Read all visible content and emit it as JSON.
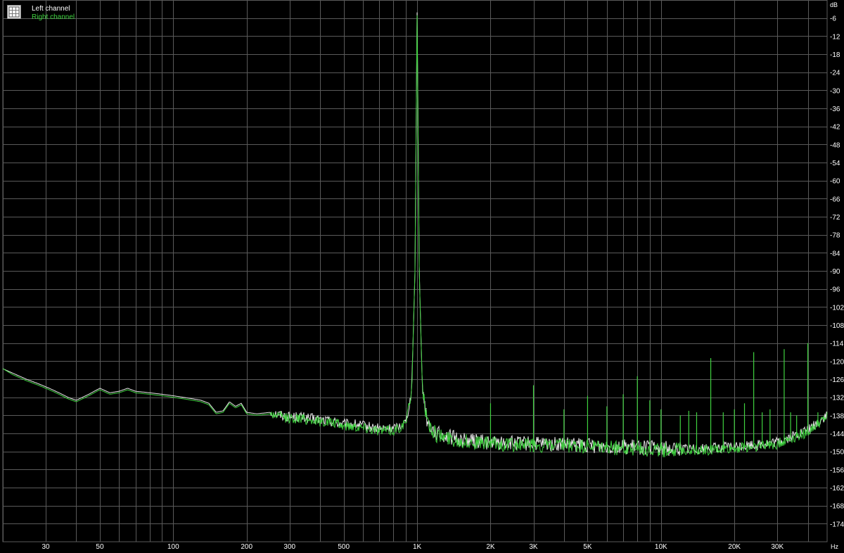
{
  "chart_data": {
    "type": "line",
    "title": "",
    "xlabel": "Hz",
    "ylabel": "dB",
    "x_scale": "log",
    "xlim": [
      20,
      48000
    ],
    "ylim": [
      -180,
      0
    ],
    "grid": true,
    "legend_position": "top-left",
    "background": "#000000",
    "grid_color": "#5a5a5a",
    "y_ticks": [
      -6,
      -12,
      -18,
      -24,
      -30,
      -36,
      -42,
      -48,
      -54,
      -60,
      -66,
      -72,
      -78,
      -84,
      -90,
      -96,
      -102,
      -108,
      -114,
      -120,
      -126,
      -132,
      -138,
      -144,
      -150,
      -156,
      -162,
      -168,
      -174
    ],
    "x_tick_labels": [
      {
        "x": 30,
        "label": "30"
      },
      {
        "x": 50,
        "label": "50"
      },
      {
        "x": 100,
        "label": "100"
      },
      {
        "x": 200,
        "label": "200"
      },
      {
        "x": 300,
        "label": "300"
      },
      {
        "x": 500,
        "label": "500"
      },
      {
        "x": 1000,
        "label": "1K"
      },
      {
        "x": 2000,
        "label": "2K"
      },
      {
        "x": 3000,
        "label": "3K"
      },
      {
        "x": 5000,
        "label": "5K"
      },
      {
        "x": 10000,
        "label": "10K"
      },
      {
        "x": 20000,
        "label": "20K"
      },
      {
        "x": 30000,
        "label": "30K"
      }
    ],
    "x_minor_gridlines": [
      20,
      30,
      40,
      50,
      60,
      70,
      80,
      90,
      100,
      200,
      300,
      400,
      500,
      600,
      700,
      800,
      900,
      1000,
      2000,
      3000,
      4000,
      5000,
      6000,
      7000,
      8000,
      9000,
      10000,
      20000,
      30000,
      40000
    ],
    "series": [
      {
        "name": "Left channel",
        "color": "#e8e8e8",
        "x": [
          20,
          22,
          25,
          28,
          31,
          34,
          37,
          40,
          45,
          50,
          55,
          60,
          65,
          70,
          80,
          90,
          100,
          110,
          120,
          130,
          140,
          150,
          160,
          170,
          180,
          190,
          200,
          220,
          250,
          280,
          300,
          330,
          360,
          400,
          450,
          500,
          550,
          600,
          650,
          700,
          750,
          800,
          850,
          900,
          950,
          980,
          1000,
          1020,
          1050,
          1100,
          1200,
          1500,
          2000,
          3000,
          5000,
          8000,
          10000,
          15000,
          20000,
          30000,
          40000,
          48000
        ],
        "y": [
          -122.5,
          -124,
          -126,
          -127.5,
          -129,
          -130.5,
          -132,
          -133,
          -131,
          -129,
          -130.5,
          -130,
          -129,
          -130,
          -130.5,
          -131,
          -131.5,
          -132,
          -132.5,
          -133,
          -134,
          -137,
          -136.5,
          -133.5,
          -135,
          -134,
          -137,
          -137.5,
          -137,
          -138,
          -138.5,
          -138.5,
          -139,
          -139.5,
          -140,
          -141,
          -141,
          -141.5,
          -142,
          -142.5,
          -142.5,
          -142.5,
          -141.5,
          -140,
          -130,
          -90,
          -2,
          -90,
          -128,
          -140,
          -144,
          -146,
          -147,
          -147.5,
          -148,
          -148.5,
          -149,
          -149,
          -148.5,
          -147,
          -143,
          -138
        ]
      },
      {
        "name": "Right channel",
        "color": "#3fd23f",
        "x": [
          20,
          22,
          25,
          28,
          31,
          34,
          37,
          40,
          45,
          50,
          55,
          60,
          65,
          70,
          80,
          90,
          100,
          110,
          120,
          130,
          140,
          150,
          160,
          170,
          180,
          190,
          200,
          220,
          250,
          280,
          300,
          330,
          360,
          400,
          450,
          500,
          550,
          600,
          650,
          700,
          750,
          800,
          850,
          900,
          950,
          980,
          1000,
          1020,
          1050,
          1100,
          1200,
          1500,
          2000,
          3000,
          5000,
          8000,
          10000,
          15000,
          20000,
          30000,
          40000,
          48000
        ],
        "y": [
          -122.5,
          -124.5,
          -126.5,
          -128,
          -129.5,
          -131,
          -132.5,
          -133.5,
          -131.5,
          -129.5,
          -131,
          -130.5,
          -129.5,
          -130.5,
          -131,
          -131.5,
          -132,
          -132.5,
          -133,
          -133.5,
          -134.5,
          -137.5,
          -137,
          -134,
          -135.5,
          -134.5,
          -137.5,
          -138,
          -137.5,
          -138.5,
          -139,
          -139,
          -139.5,
          -140,
          -140.5,
          -141.5,
          -141.5,
          -142,
          -142.5,
          -143,
          -143,
          -143,
          -142,
          -140.5,
          -130,
          -90,
          -3,
          -90,
          -128,
          -140.5,
          -144.5,
          -146.5,
          -147.5,
          -148,
          -148.5,
          -149,
          -149.5,
          -149.5,
          -149,
          -147.5,
          -143.5,
          -138.5
        ]
      }
    ],
    "harmonic_spikes": [
      {
        "x": 2000,
        "y": -134
      },
      {
        "x": 3000,
        "y": -128
      },
      {
        "x": 4000,
        "y": -136
      },
      {
        "x": 5000,
        "y": -131.5
      },
      {
        "x": 6000,
        "y": -135
      },
      {
        "x": 7000,
        "y": -131
      },
      {
        "x": 8000,
        "y": -125
      },
      {
        "x": 9000,
        "y": -133
      },
      {
        "x": 10000,
        "y": -136
      },
      {
        "x": 12000,
        "y": -138
      },
      {
        "x": 13000,
        "y": -136.5
      },
      {
        "x": 14000,
        "y": -137
      },
      {
        "x": 16000,
        "y": -119
      },
      {
        "x": 18000,
        "y": -137
      },
      {
        "x": 20000,
        "y": -136
      },
      {
        "x": 22000,
        "y": -134
      },
      {
        "x": 24000,
        "y": -117
      },
      {
        "x": 26000,
        "y": -137
      },
      {
        "x": 28000,
        "y": -136
      },
      {
        "x": 32000,
        "y": -116
      },
      {
        "x": 34000,
        "y": -137
      },
      {
        "x": 36000,
        "y": -138
      },
      {
        "x": 40000,
        "y": -114
      },
      {
        "x": 44000,
        "y": -137
      }
    ]
  },
  "legend": {
    "items": [
      {
        "label": "Left channel",
        "color": "#e8e8e8"
      },
      {
        "label": "Right channel",
        "color": "#3fd23f"
      }
    ]
  }
}
